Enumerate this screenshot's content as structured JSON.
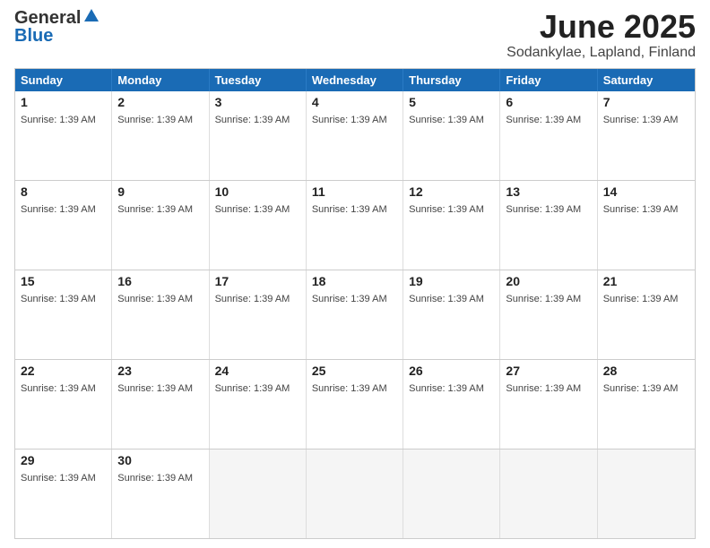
{
  "header": {
    "logo_general": "General",
    "logo_blue": "Blue",
    "month_year": "June 2025",
    "location": "Sodankylae, Lapland, Finland"
  },
  "days_of_week": [
    "Sunday",
    "Monday",
    "Tuesday",
    "Wednesday",
    "Thursday",
    "Friday",
    "Saturday"
  ],
  "sunrise": "Sunrise: 1:39 AM",
  "weeks": [
    [
      {
        "day": "1",
        "empty": false
      },
      {
        "day": "2",
        "empty": false
      },
      {
        "day": "3",
        "empty": false
      },
      {
        "day": "4",
        "empty": false
      },
      {
        "day": "5",
        "empty": false
      },
      {
        "day": "6",
        "empty": false
      },
      {
        "day": "7",
        "empty": false
      }
    ],
    [
      {
        "day": "8",
        "empty": false
      },
      {
        "day": "9",
        "empty": false
      },
      {
        "day": "10",
        "empty": false
      },
      {
        "day": "11",
        "empty": false
      },
      {
        "day": "12",
        "empty": false
      },
      {
        "day": "13",
        "empty": false
      },
      {
        "day": "14",
        "empty": false
      }
    ],
    [
      {
        "day": "15",
        "empty": false
      },
      {
        "day": "16",
        "empty": false
      },
      {
        "day": "17",
        "empty": false
      },
      {
        "day": "18",
        "empty": false
      },
      {
        "day": "19",
        "empty": false
      },
      {
        "day": "20",
        "empty": false
      },
      {
        "day": "21",
        "empty": false
      }
    ],
    [
      {
        "day": "22",
        "empty": false
      },
      {
        "day": "23",
        "empty": false
      },
      {
        "day": "24",
        "empty": false
      },
      {
        "day": "25",
        "empty": false
      },
      {
        "day": "26",
        "empty": false
      },
      {
        "day": "27",
        "empty": false
      },
      {
        "day": "28",
        "empty": false
      }
    ],
    [
      {
        "day": "29",
        "empty": false
      },
      {
        "day": "30",
        "empty": false
      },
      {
        "day": "",
        "empty": true
      },
      {
        "day": "",
        "empty": true
      },
      {
        "day": "",
        "empty": true
      },
      {
        "day": "",
        "empty": true
      },
      {
        "day": "",
        "empty": true
      }
    ]
  ]
}
